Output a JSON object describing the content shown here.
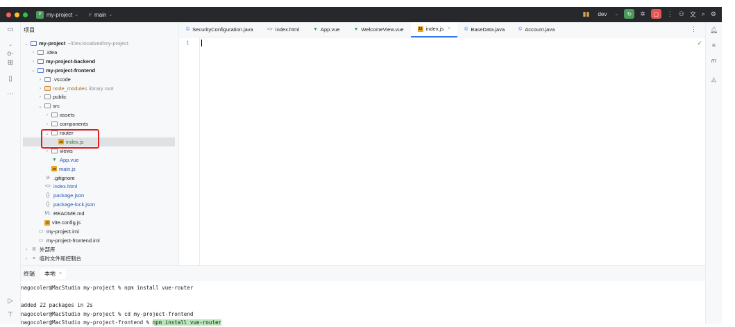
{
  "titlebar": {
    "project_badge": "P",
    "project_name": "my-project",
    "branch": "main",
    "run_config": "dev",
    "colors": {
      "close": "#ff5f57",
      "minimize": "#febc2e",
      "maximize": "#28c840",
      "run": "#4c9a5b",
      "stop": "#e55353"
    }
  },
  "project_panel": {
    "title": "项目"
  },
  "tree": [
    {
      "indent": 0,
      "chevron": "v",
      "icon": "module-folder",
      "label": "my-project",
      "suffix": "~/Dev.localized/my-project",
      "bold": true
    },
    {
      "indent": 1,
      "chevron": ">",
      "icon": "folder",
      "label": ".idea"
    },
    {
      "indent": 1,
      "chevron": ">",
      "icon": "module-folder",
      "label": "my-project-backend",
      "bold": true
    },
    {
      "indent": 1,
      "chevron": "v",
      "icon": "module-folder",
      "label": "my-project-frontend",
      "bold": true
    },
    {
      "indent": 2,
      "chevron": ">",
      "icon": "folder",
      "label": ".vscode"
    },
    {
      "indent": 2,
      "chevron": ">",
      "icon": "folder-orange",
      "label": "node_modules",
      "suffix": "library root",
      "color": "orange"
    },
    {
      "indent": 2,
      "chevron": ">",
      "icon": "folder",
      "label": "public"
    },
    {
      "indent": 2,
      "chevron": "v",
      "icon": "folder",
      "label": "src"
    },
    {
      "indent": 3,
      "chevron": ">",
      "icon": "folder",
      "label": "assets"
    },
    {
      "indent": 3,
      "chevron": ">",
      "icon": "folder",
      "label": "components"
    },
    {
      "indent": 3,
      "chevron": "v",
      "icon": "folder",
      "label": "router"
    },
    {
      "indent": 4,
      "chevron": "",
      "icon": "js",
      "label": "index.js",
      "selected": true,
      "color": "green"
    },
    {
      "indent": 3,
      "chevron": ">",
      "icon": "folder",
      "label": "views"
    },
    {
      "indent": 3,
      "chevron": "",
      "icon": "vue",
      "label": "App.vue",
      "color": "blue"
    },
    {
      "indent": 3,
      "chevron": "",
      "icon": "js",
      "label": "main.js",
      "color": "blue"
    },
    {
      "indent": 2,
      "chevron": "",
      "icon": "gitignore",
      "label": ".gitignore"
    },
    {
      "indent": 2,
      "chevron": "",
      "icon": "html",
      "label": "index.html",
      "color": "blue"
    },
    {
      "indent": 2,
      "chevron": "",
      "icon": "json",
      "label": "package.json",
      "color": "blue"
    },
    {
      "indent": 2,
      "chevron": "",
      "icon": "json",
      "label": "package-lock.json",
      "color": "blue"
    },
    {
      "indent": 2,
      "chevron": "",
      "icon": "md",
      "label": "README.md"
    },
    {
      "indent": 2,
      "chevron": "",
      "icon": "js",
      "label": "vite.config.js"
    },
    {
      "indent": 1,
      "chevron": "",
      "icon": "iml",
      "label": "my-project.iml"
    },
    {
      "indent": 1,
      "chevron": "",
      "icon": "iml",
      "label": "my-project-frontend.iml"
    },
    {
      "indent": 0,
      "chevron": ">",
      "icon": "library",
      "label": "外部库"
    },
    {
      "indent": 0,
      "chevron": ">",
      "icon": "scratch",
      "label": "临时文件和控制台"
    }
  ],
  "editor": {
    "tabs": [
      {
        "icon": "class",
        "label": "SecurityConfiguration.java"
      },
      {
        "icon": "html",
        "label": "index.html"
      },
      {
        "icon": "vue",
        "label": "App.vue"
      },
      {
        "icon": "vue",
        "label": "WelcomeView.vue"
      },
      {
        "icon": "js",
        "label": "index.js",
        "active": true,
        "closable": true
      },
      {
        "icon": "class",
        "label": "BaseData.java"
      },
      {
        "icon": "class",
        "label": "Account.java"
      }
    ],
    "line_number": "1",
    "accent": "#3574f0"
  },
  "terminal": {
    "title": "终端",
    "tab_local": "本地",
    "lines": [
      {
        "text": "nagocoler@MacStudio my-project % npm install vue-router"
      },
      {
        "text": ""
      },
      {
        "text": "added 22 packages in 2s"
      },
      {
        "text": "nagocoler@MacStudio my-project % cd my-project-frontend"
      },
      {
        "prompt": "nagocoler@MacStudio my-project-frontend % ",
        "highlight": "npm install vue-router"
      }
    ]
  }
}
